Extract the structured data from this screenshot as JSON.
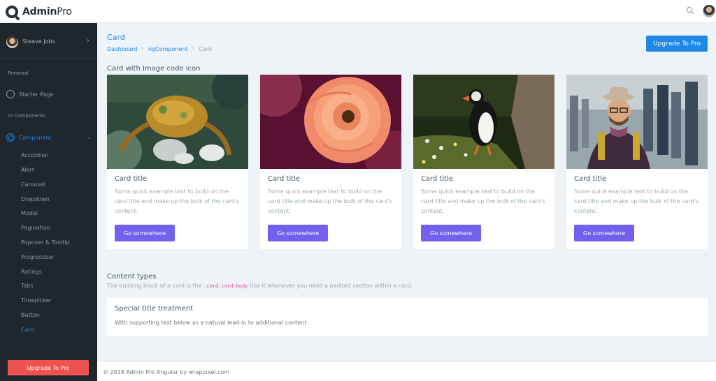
{
  "brand": {
    "bold": "Admin",
    "rest": "Pro"
  },
  "user": {
    "name": "Steave Jobs"
  },
  "sidebar": {
    "caption_personal": "Personal",
    "starter": "Starter Page",
    "caption_ui": "UI Components",
    "component": "Component",
    "sub_items": [
      "Accordion",
      "Alert",
      "Carousel",
      "Dropdown",
      "Model",
      "Pagination",
      "Popover & Tooltip",
      "Progressbar",
      "Ratings",
      "Tabs",
      "Timepicker",
      "Button",
      "Card"
    ],
    "upgrade": "Upgrade To Pro"
  },
  "header": {
    "title": "Card",
    "breadcrumb": [
      "Dashboard",
      "ngComponent",
      "Card"
    ],
    "upgrade": "Upgrade To Pro"
  },
  "cards_section": {
    "title": "Card with Image code icon"
  },
  "cards": [
    {
      "image": "crab photo",
      "title": "Card title",
      "text": "Some quick example text to build on the card title and make up the bulk of the card's content.",
      "button": "Go somewhere"
    },
    {
      "image": "rose photo",
      "title": "Card title",
      "text": "Some quick example text to build on the card title and make up the bulk of the card's content.",
      "button": "Go somewhere"
    },
    {
      "image": "puffin photo",
      "title": "Card title",
      "text": "Some quick example text to build on the card title and make up the bulk of the card's content.",
      "button": "Go somewhere"
    },
    {
      "image": "man in street photo",
      "title": "Card title",
      "text": "Some quick example text to build on the card title and make up the bulk of the card's content.",
      "button": "Go somewhere"
    }
  ],
  "content_types": {
    "title": "Content types",
    "desc_before": "The building block of a card is the",
    "code": ".card.card-body",
    "desc_after": "Use it whenever you need a padded section within a card."
  },
  "special": {
    "title": "Special title treatment",
    "text": "With supporting text below as a natural lead-in to additional content."
  },
  "footer": {
    "text": "© 2018 Admin Pro Angular by wrappixel.com"
  },
  "colors": {
    "primary": "#1e88e5",
    "purple": "#7460ee",
    "danger": "#ef5350",
    "sidebar": "#1f262d"
  },
  "icons": [
    "search-icon",
    "avatar",
    "gauge-icon",
    "target-icon",
    "chevron-right-icon",
    "chevron-down-icon"
  ]
}
